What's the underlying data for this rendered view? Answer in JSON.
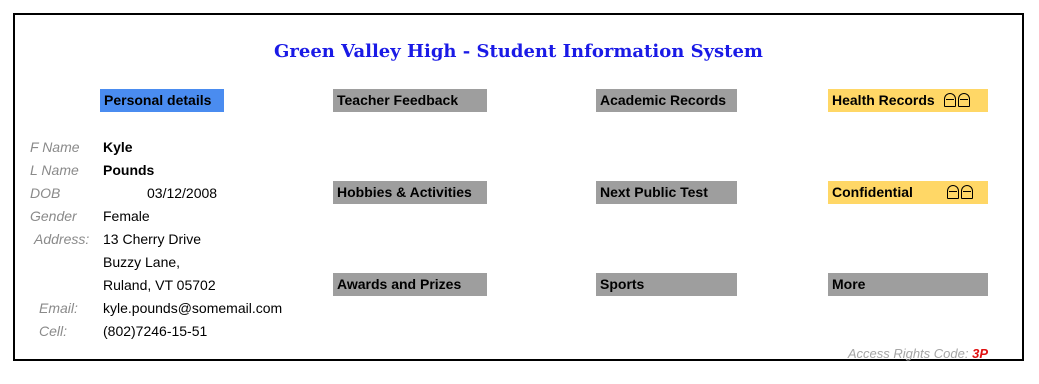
{
  "title": "Green Valley High - Student Information System",
  "tabs": {
    "personal": "Personal details",
    "teacher_feedback": "Teacher Feedback",
    "academic_records": "Academic Records",
    "health_records": "Health Records",
    "hobbies": "Hobbies & Activities",
    "next_public_test": "Next Public Test",
    "confidential": "Confidential",
    "awards": "Awards and Prizes",
    "sports": "Sports",
    "more": "More"
  },
  "labels": {
    "fname": "F Name",
    "lname": "L Name",
    "dob": "DOB",
    "gender": "Gender",
    "address": "Address:",
    "email": "Email:",
    "cell": "Cell:"
  },
  "student": {
    "fname": "Kyle",
    "lname": "Pounds",
    "dob": "03/12/2008",
    "gender": "Female",
    "address_line1": "13 Cherry Drive",
    "address_line2": "Buzzy Lane,",
    "address_line3": "Ruland, VT 05702",
    "email": "kyle.pounds@somemail.com",
    "cell": "(802)7246-15-51"
  },
  "access": {
    "label": "Access Rights Code: ",
    "code": "3P"
  },
  "colors": {
    "title": "#1a1ae6",
    "active_tab": "#4a8cf0",
    "tab": "#9e9e9e",
    "restricted_tab": "#ffd766",
    "access_code": "#e01010"
  },
  "icons": {
    "restricted": "lock-icon"
  }
}
